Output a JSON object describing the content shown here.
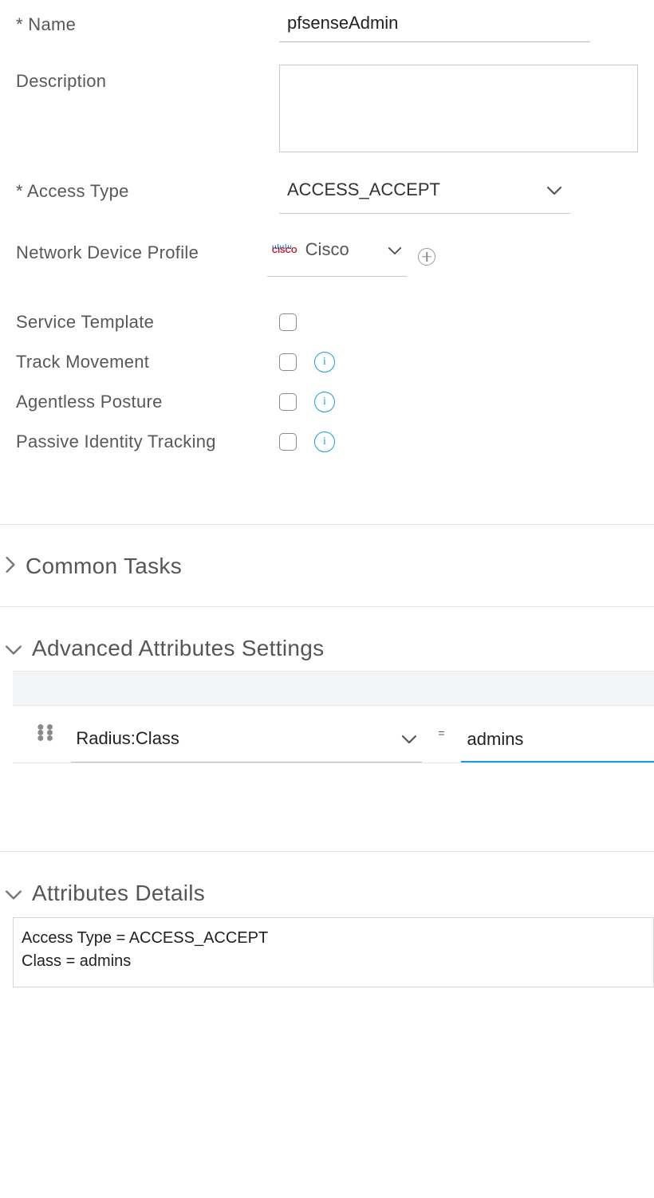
{
  "fields": {
    "name": {
      "label": "* Name",
      "value": "pfsenseAdmin"
    },
    "description": {
      "label": "Description",
      "value": ""
    },
    "access_type": {
      "label": "* Access Type",
      "value": "ACCESS_ACCEPT"
    },
    "network_device_profile": {
      "label": "Network Device Profile",
      "value": "Cisco"
    }
  },
  "checkboxes": {
    "service_template": {
      "label": "Service Template",
      "checked": false,
      "info": false
    },
    "track_movement": {
      "label": "Track Movement",
      "checked": false,
      "info": true
    },
    "agentless_posture": {
      "label": "Agentless Posture",
      "checked": false,
      "info": true
    },
    "passive_identity_tracking": {
      "label": "Passive Identity Tracking",
      "checked": false,
      "info": true
    }
  },
  "sections": {
    "common_tasks": {
      "title": "Common Tasks",
      "expanded": false
    },
    "advanced_attributes": {
      "title": "Advanced Attributes Settings",
      "expanded": true
    },
    "attributes_details": {
      "title": "Attributes Details",
      "expanded": true
    }
  },
  "advanced_attribute": {
    "attribute": "Radius:Class",
    "operator": "=",
    "value": "admins"
  },
  "attributes_details": {
    "line1": "Access Type = ACCESS_ACCEPT",
    "line2": "Class = admins"
  }
}
